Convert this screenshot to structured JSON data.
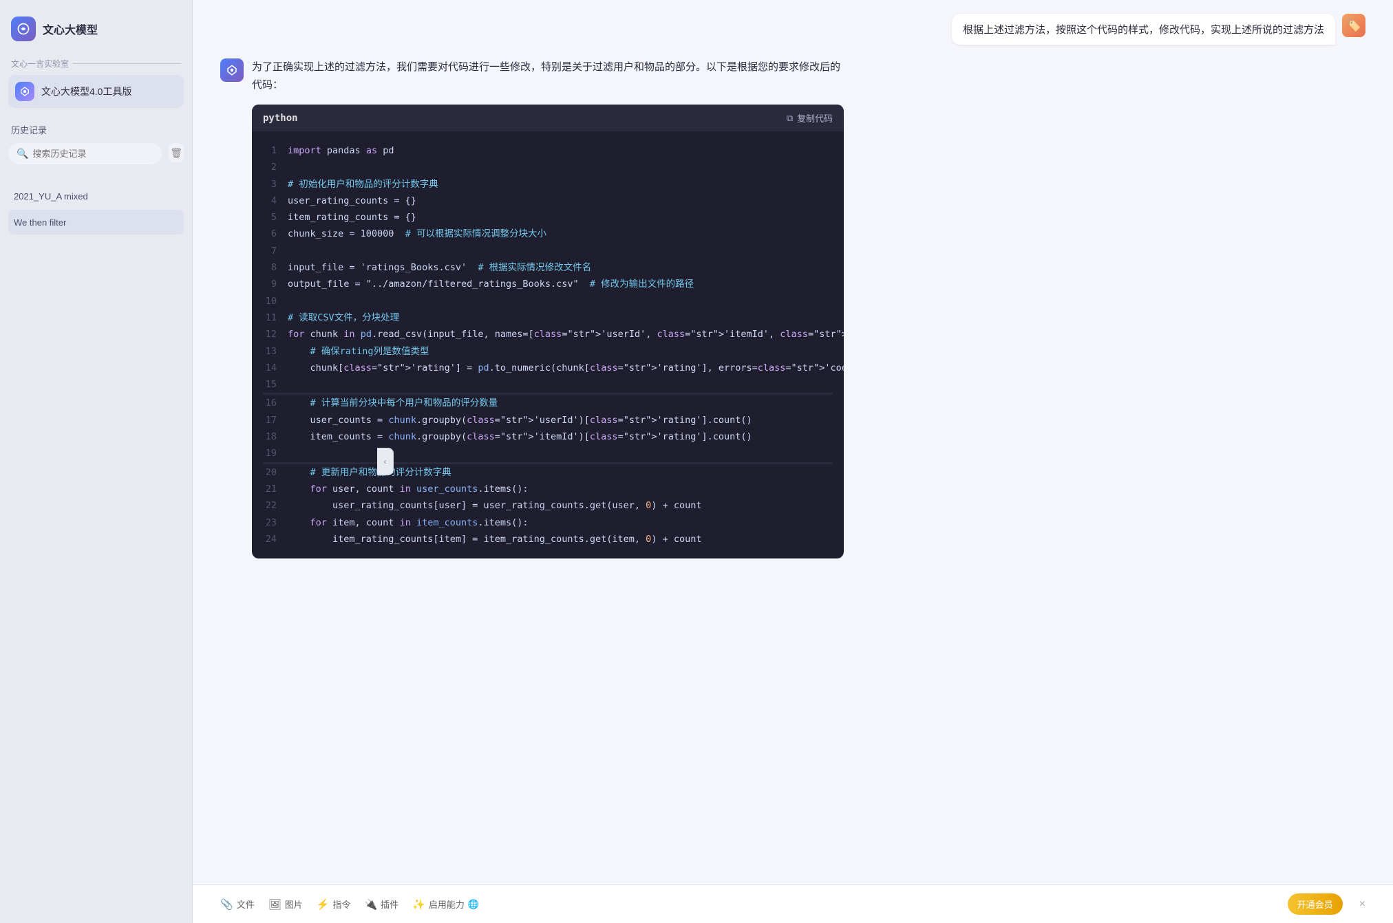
{
  "app": {
    "title": "文心大模型",
    "logo_emoji": "🔵",
    "section_label": "文心一言实验室"
  },
  "sidebar": {
    "model_item": {
      "label": "文心大模型4.0工具版",
      "icon_emoji": "🔷"
    },
    "history_label": "历史记录",
    "search_placeholder": "搜索历史记录",
    "history_items": [
      {
        "id": "1",
        "text": "2021_YU_A mixed",
        "active": false
      },
      {
        "id": "2",
        "text": "We then filter",
        "active": true
      }
    ]
  },
  "chat": {
    "user_message": "根据上述过滤方法，按照这个代码的样式，修改代码，实现上述所说的过滤方法",
    "ai_intro": "为了正确实现上述的过滤方法，我们需要对代码进行一些修改，特别是关于过滤用户和物品的部分。以下是根据您的要求修改后的代码：",
    "code_lang": "python",
    "copy_label": "复制代码"
  },
  "code_lines": [
    {
      "num": 1,
      "content": "import pandas as pd"
    },
    {
      "num": 2,
      "content": ""
    },
    {
      "num": 3,
      "content": "# 初始化用户和物品的评分计数字典"
    },
    {
      "num": 4,
      "content": "user_rating_counts = {}"
    },
    {
      "num": 5,
      "content": "item_rating_counts = {}"
    },
    {
      "num": 6,
      "content": "chunk_size = 100000  # 可以根据实际情况调整分块大小"
    },
    {
      "num": 7,
      "content": ""
    },
    {
      "num": 8,
      "content": "input_file = 'ratings_Books.csv'  # 根据实际情况修改文件名"
    },
    {
      "num": 9,
      "content": "output_file = \"../amazon/filtered_ratings_Books.csv\"  # 修改为输出文件的路径"
    },
    {
      "num": 10,
      "content": ""
    },
    {
      "num": 11,
      "content": "# 读取CSV文件，分块处理"
    },
    {
      "num": 12,
      "content": "for chunk in pd.read_csv(input_file, names=['userId', 'itemId', 'rating', 'timestamp'"
    },
    {
      "num": 13,
      "content": "    # 确保rating列是数值类型"
    },
    {
      "num": 14,
      "content": "    chunk['rating'] = pd.to_numeric(chunk['rating'], errors='coerce')"
    },
    {
      "num": 15,
      "content": ""
    },
    {
      "num": 16,
      "content": "    # 计算当前分块中每个用户和物品的评分数量"
    },
    {
      "num": 17,
      "content": "    user_counts = chunk.groupby('userId')['rating'].count()"
    },
    {
      "num": 18,
      "content": "    item_counts = chunk.groupby('itemId')['rating'].count()"
    },
    {
      "num": 19,
      "content": ""
    },
    {
      "num": 20,
      "content": "    # 更新用户和物品的评分计数字典"
    },
    {
      "num": 21,
      "content": "    for user, count in user_counts.items():"
    },
    {
      "num": 22,
      "content": "        user_rating_counts[user] = user_rating_counts.get(user, 0) + count"
    },
    {
      "num": 23,
      "content": "    for item, count in item_counts.items():"
    },
    {
      "num": 24,
      "content": "        item_rating_counts[item] = item_rating_counts.get(item, 0) + count"
    }
  ],
  "bottom_bar": {
    "tools": [
      {
        "icon": "📎",
        "label": "文件"
      },
      {
        "icon": "🖼️",
        "label": "图片"
      },
      {
        "icon": "⚡",
        "label": "指令"
      },
      {
        "icon": "🔌",
        "label": "插件"
      },
      {
        "icon": "✨",
        "label": "启用能力"
      }
    ],
    "vip_label": "开通会员",
    "vip_close": "×"
  }
}
